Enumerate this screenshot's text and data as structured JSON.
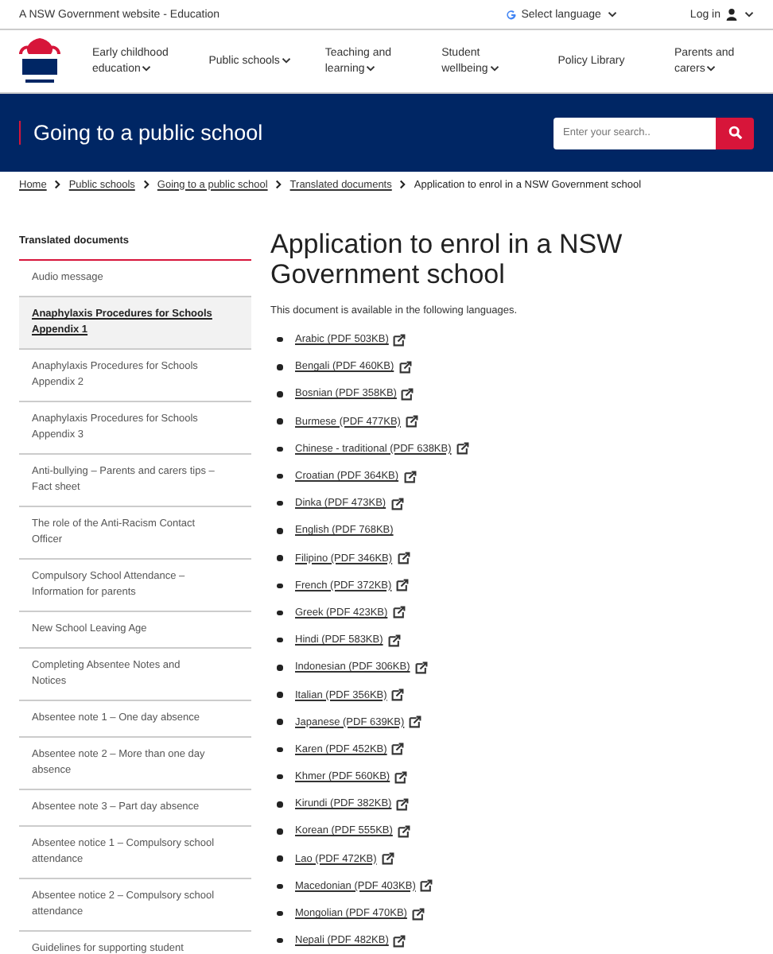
{
  "top_bar": {
    "site_label": "A NSW Government website - Education",
    "language_button": "Select language",
    "login_button": "Log in"
  },
  "nav": {
    "items": [
      {
        "label": "Early childhood education",
        "dropdown": true
      },
      {
        "label": "Public schools",
        "dropdown": true
      },
      {
        "label": "Teaching and learning",
        "dropdown": true
      },
      {
        "label": "Student wellbeing",
        "dropdown": true
      },
      {
        "label": "Policy Library",
        "dropdown": false
      },
      {
        "label": "Parents and carers",
        "dropdown": true
      }
    ]
  },
  "banner": {
    "title": "Going to a public school",
    "search": {
      "placeholder": "Enter your search.."
    }
  },
  "breadcrumb": [
    {
      "label": "Home",
      "link": true
    },
    {
      "label": "Public schools",
      "link": true
    },
    {
      "label": "Going to a public school",
      "link": true
    },
    {
      "label": "Translated documents",
      "link": true
    },
    {
      "label": "Application to enrol in a NSW Government school",
      "link": false
    }
  ],
  "sidebar": {
    "heading": "Translated documents",
    "items": [
      {
        "label": "Audio message",
        "selected": false
      },
      {
        "label": "Anaphylaxis Procedures for Schools Appendix 1",
        "selected": true
      },
      {
        "label": "Anaphylaxis Procedures for Schools Appendix 2",
        "selected": false
      },
      {
        "label": "Anaphylaxis Procedures for Schools Appendix 3",
        "selected": false
      },
      {
        "label": "Anti-bullying – Parents and carers tips – Fact sheet",
        "selected": false
      },
      {
        "label": "The role of the Anti-Racism Contact Officer",
        "selected": false
      },
      {
        "label": "Compulsory School Attendance – Information for parents",
        "selected": false
      },
      {
        "label": "New School Leaving Age",
        "selected": false
      },
      {
        "label": "Completing Absentee Notes and Notices",
        "selected": false
      },
      {
        "label": "Absentee note 1 – One day absence",
        "selected": false
      },
      {
        "label": "Absentee note 2 – More than one day absence",
        "selected": false
      },
      {
        "label": "Absentee note 3 – Part day absence",
        "selected": false
      },
      {
        "label": "Absentee notice 1 – Compulsory school attendance",
        "selected": false
      },
      {
        "label": "Absentee notice 2 – Compulsory school attendance",
        "selected": false
      },
      {
        "label": "Guidelines for supporting student",
        "selected": false
      }
    ]
  },
  "content": {
    "title": "Application to enrol in a NSW Government school",
    "intro": "This document is available in the following languages.",
    "documents": [
      {
        "label": "Arabic (PDF 503KB)",
        "external": true
      },
      {
        "label": "Bengali (PDF 460KB)",
        "external": true
      },
      {
        "label": "Bosnian (PDF 358KB)",
        "external": true
      },
      {
        "label": "Burmese (PDF 477KB)",
        "external": true
      },
      {
        "label": "Chinese - traditional (PDF 638KB)",
        "external": true
      },
      {
        "label": "Croatian (PDF 364KB)",
        "external": true
      },
      {
        "label": "Dinka (PDF 473KB)",
        "external": true
      },
      {
        "label": "English (PDF 768KB)",
        "external": false
      },
      {
        "label": "Filipino (PDF 346KB)",
        "external": true
      },
      {
        "label": "French (PDF 372KB)",
        "external": true
      },
      {
        "label": "Greek (PDF 423KB)",
        "external": true
      },
      {
        "label": "Hindi (PDF 583KB)",
        "external": true
      },
      {
        "label": "Indonesian (PDF 306KB)",
        "external": true
      },
      {
        "label": "Italian (PDF 356KB)",
        "external": true
      },
      {
        "label": "Japanese (PDF 639KB)",
        "external": true
      },
      {
        "label": "Karen (PDF 452KB)",
        "external": true
      },
      {
        "label": "Khmer (PDF 560KB)",
        "external": true
      },
      {
        "label": "Kirundi (PDF 382KB)",
        "external": true
      },
      {
        "label": "Korean (PDF 555KB)",
        "external": true
      },
      {
        "label": "Lao (PDF 472KB)",
        "external": true
      },
      {
        "label": "Macedonian (PDF 403KB)",
        "external": true
      },
      {
        "label": "Mongolian (PDF 470KB)",
        "external": true
      },
      {
        "label": "Nepali (PDF 482KB)",
        "external": true
      }
    ]
  }
}
